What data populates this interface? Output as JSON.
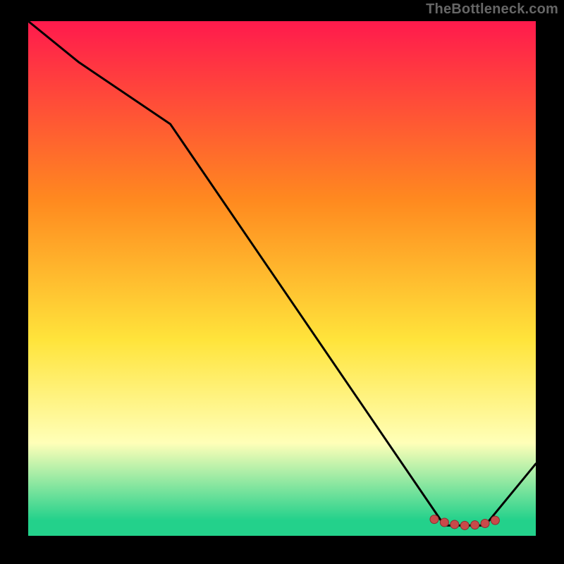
{
  "watermark": {
    "text": "TheBottleneck.com"
  },
  "colors": {
    "bg": "#000000",
    "frame": "#000000",
    "line": "#000000",
    "marker_fill": "#c94a4a",
    "marker_stroke": "#8b2f2f",
    "grad_top": "#ff1a4d",
    "grad_mid1": "#ff8a1f",
    "grad_mid2": "#ffe43b",
    "grad_pale": "#ffffb8",
    "grad_bottom": "#23d18b",
    "watermark": "#666666"
  },
  "chart_data": {
    "type": "line",
    "title": "",
    "xlabel": "",
    "ylabel": "",
    "xlim": [
      0,
      100
    ],
    "ylim": [
      0,
      100
    ],
    "grid": false,
    "legend": false,
    "series": [
      {
        "name": "curve",
        "x": [
          0,
          10,
          28,
          82,
          90,
          100
        ],
        "y": [
          100,
          92,
          80,
          2,
          2,
          14
        ]
      }
    ],
    "markers": {
      "x": [
        80,
        82,
        84,
        86,
        88,
        90,
        92
      ],
      "y": [
        3.2,
        2.6,
        2.2,
        2.0,
        2.1,
        2.4,
        3.0
      ]
    },
    "background_gradient": {
      "stops": [
        {
          "offset": 0.0,
          "color": "#ff1a4d"
        },
        {
          "offset": 0.35,
          "color": "#ff8a1f"
        },
        {
          "offset": 0.62,
          "color": "#ffe43b"
        },
        {
          "offset": 0.82,
          "color": "#ffffb8"
        },
        {
          "offset": 0.97,
          "color": "#23d18b"
        }
      ]
    }
  }
}
